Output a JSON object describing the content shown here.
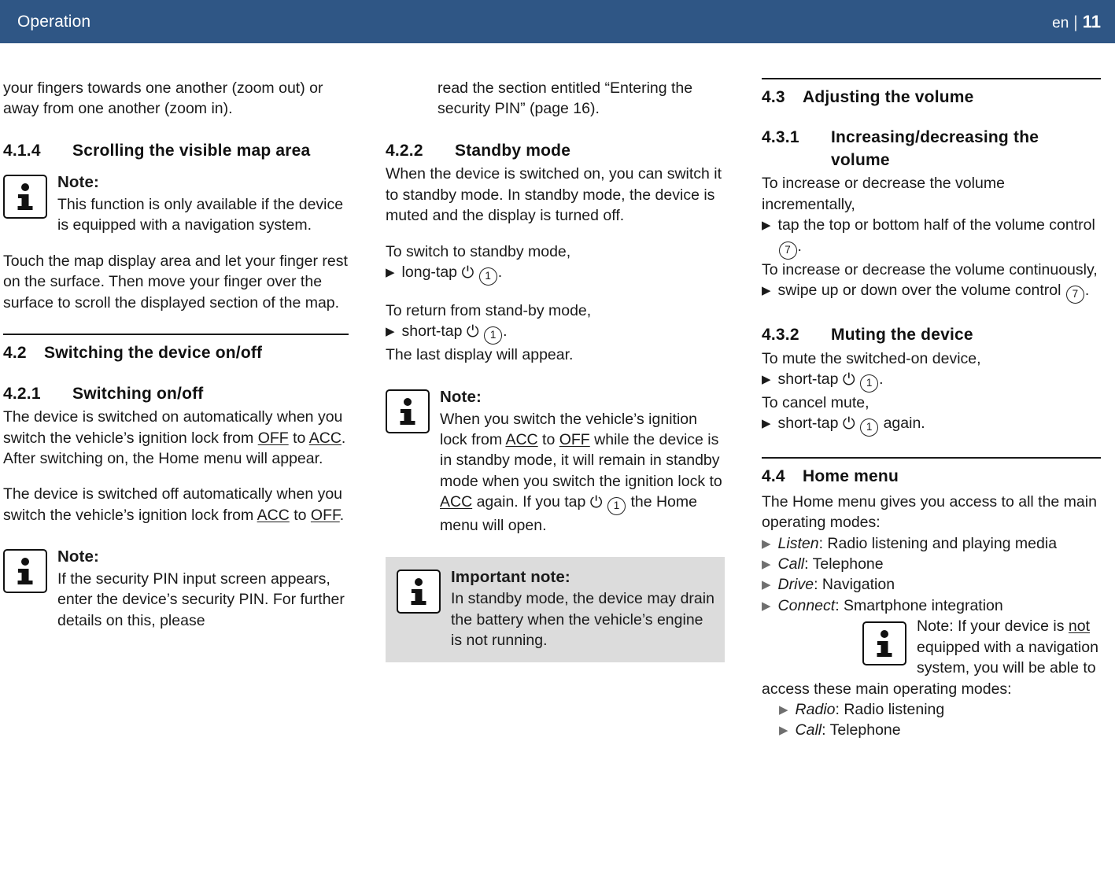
{
  "header": {
    "title": "Operation",
    "language": "en",
    "separator": "|",
    "page_number": "11"
  },
  "column1": {
    "intro_paragraph": "your fingers towards one another (zoom out) or away from one another (zoom in).",
    "section_414": {
      "number": "4.1.4",
      "title": "Scrolling the visible map area"
    },
    "note_nav": {
      "label": "Note:",
      "text": "This function is only available if the device is equipped with a navigation system.",
      "icon": "info-icon"
    },
    "touch_paragraph": "Touch the map display area and let your finger rest on the surface. Then move your finger over the surface to scroll the displayed section of the map.",
    "section_42": {
      "number": "4.2",
      "title": "Switching the device on/off"
    },
    "section_421": {
      "number": "4.2.1",
      "title": "Switching on/off"
    },
    "on_text_1": "The device is switched on automatically when you switch the vehicle’s ignition lock from ",
    "on_off_label": "OFF",
    "on_text_2": " to ",
    "on_acc_label": "ACC",
    "on_text_3": ".",
    "on_text_4": "After switching on, the Home menu will appear.",
    "off_text_1": "The device is switched off automatically when you switch the vehicle’s ignition lock from ",
    "off_acc_label": "ACC",
    "off_text_2": " to ",
    "off_off_label": "OFF",
    "off_text_3": ".",
    "note_pin": {
      "label": "Note:",
      "text": "If the security PIN input screen appears, enter the device’s security PIN. For further details on this, please",
      "icon": "info-icon"
    }
  },
  "column2": {
    "note_pin_continued": "read the section entitled “Entering the security PIN” (page 16).",
    "section_422": {
      "number": "4.2.2",
      "title": "Standby mode"
    },
    "standby_paragraph": "When the device is switched on, you can switch it to standby mode. In standby mode, the device is muted and the display is turned off.",
    "to_switch_label": "To switch to standby mode,",
    "long_tap_bullet": {
      "triangle": "▶",
      "action": "long-tap",
      "power_icon": "power-icon",
      "callout": "1",
      "suffix": "."
    },
    "to_return_label": "To return from stand-by mode,",
    "short_tap_bullet": {
      "triangle": "▶",
      "action": "short-tap",
      "power_icon": "power-icon",
      "callout": "1",
      "suffix": "."
    },
    "last_display_label": "The last display will appear.",
    "note_ignition": {
      "label": "Note:",
      "icon": "info-icon",
      "t1": "When you switch the vehicle’s ignition lock from ",
      "acc1": "ACC",
      "t2": " to ",
      "off1": "OFF",
      "t3": " while the device is in standby mode, it will remain in standby mode when you switch the ignition lock to ",
      "acc2": "ACC",
      "t4": " again. If you tap ",
      "power_icon": "power-icon",
      "callout": "1",
      "t5": " the Home menu will open."
    },
    "important_note": {
      "label": "Important note:",
      "icon": "info-icon",
      "text": "In standby mode, the device may drain the battery when the vehicle’s engine is not running.",
      "background": "#dcdcdc"
    }
  },
  "column3": {
    "section_43": {
      "number": "4.3",
      "title": "Adjusting the volume"
    },
    "section_431": {
      "number": "4.3.1",
      "title_line1": "Increasing/decreasing the",
      "title_line2": "volume"
    },
    "increment_intro": "To increase or decrease the volume incrementally,",
    "tap_bullet": {
      "triangle": "▶",
      "text_line1": "tap the top or bottom half of the volume",
      "text_line2_prefix": "control ",
      "callout": "7",
      "text_line2_suffix": "."
    },
    "continuous_intro": "To increase or decrease the volume continuously,",
    "swipe_bullet": {
      "triangle": "▶",
      "text_line1": "swipe up or down over the volume control",
      "callout": "7",
      "suffix": "."
    },
    "section_432": {
      "number": "4.3.2",
      "title": "Muting the device"
    },
    "mute_intro": "To mute the switched-on device,",
    "mute_bullet": {
      "triangle": "▶",
      "action": "short-tap",
      "power_icon": "power-icon",
      "callout": "1",
      "suffix": "."
    },
    "cancel_intro": "To cancel mute,",
    "cancel_bullet": {
      "triangle": "▶",
      "action": "short-tap",
      "power_icon": "power-icon",
      "callout": "1",
      "suffix": " again."
    },
    "section_44": {
      "number": "4.4",
      "title": "Home menu"
    },
    "home_paragraph": "The Home menu gives you access to all the main operating modes:",
    "modes": [
      {
        "triangle": "▶",
        "name": "Listen",
        "desc": ": Radio listening and playing media"
      },
      {
        "triangle": "▶",
        "name": "Call",
        "desc": ": Telephone"
      },
      {
        "triangle": "▶",
        "name": "Drive",
        "desc": ": Navigation"
      },
      {
        "triangle": "▶",
        "name": "Connect",
        "desc": ": Smartphone integration"
      }
    ],
    "note_no_nav": {
      "icon": "info-icon",
      "t1": "Note: If your device is ",
      "not_label": "not",
      "t2": " equipped with a navigation system, you will be able to"
    },
    "access_line": "access these main operating modes:",
    "modes_no_nav": [
      {
        "triangle": "▶",
        "name": "Radio",
        "desc": ": Radio listening"
      },
      {
        "triangle": "▶",
        "name": "Call",
        "desc": ": Telephone"
      }
    ]
  },
  "colors": {
    "header_blue": "#2f5685",
    "shaded_box": "#dcdcdc",
    "text": "#1a1a1a"
  }
}
